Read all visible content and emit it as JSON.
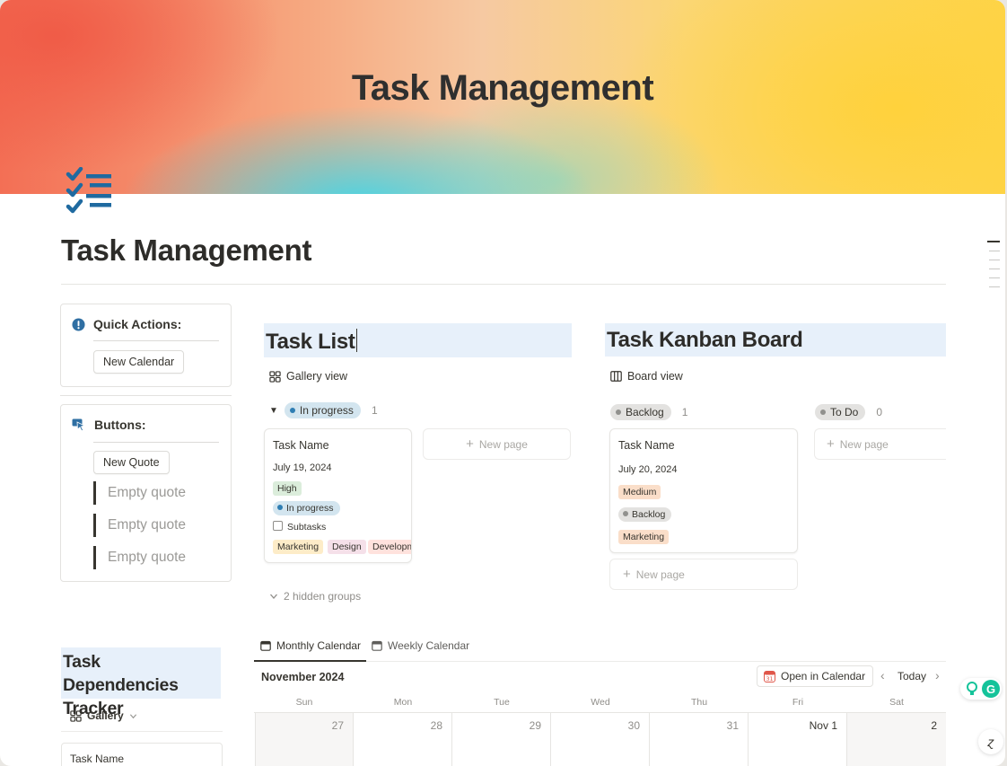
{
  "cover": {
    "title": "Task Management"
  },
  "page": {
    "title": "Task Management"
  },
  "quick_actions": {
    "heading": "Quick Actions:",
    "button": "New Calendar"
  },
  "buttons_block": {
    "heading": "Buttons:",
    "button": "New Quote",
    "quotes": [
      "Empty quote",
      "Empty quote",
      "Empty quote"
    ]
  },
  "task_list": {
    "heading": "Task List",
    "view": "Gallery view",
    "group": {
      "label": "In progress",
      "count": "1"
    },
    "card": {
      "title": "Task Name",
      "date": "July 19, 2024",
      "priority": "High",
      "status": "In progress",
      "subtasks": "Subtasks",
      "tags": [
        "Marketing",
        "Design",
        "Developm"
      ]
    },
    "new_page": "New page",
    "hidden_groups": "2 hidden groups"
  },
  "kanban": {
    "heading": "Task Kanban Board",
    "view": "Board view",
    "columns": [
      {
        "label": "Backlog",
        "count": "1"
      },
      {
        "label": "To Do",
        "count": "0"
      }
    ],
    "card": {
      "title": "Task Name",
      "date": "July 20, 2024",
      "priority": "Medium",
      "status": "Backlog",
      "tag": "Marketing"
    },
    "new_page": "New page"
  },
  "dependencies": {
    "heading": "Task Dependencies Tracker",
    "view": "Gallery",
    "card_title": "Task Name"
  },
  "calendar": {
    "tabs": [
      "Monthly Calendar",
      "Weekly Calendar"
    ],
    "month": "November 2024",
    "open_button": "Open in Calendar",
    "today": "Today",
    "weekdays": [
      "Sun",
      "Mon",
      "Tue",
      "Wed",
      "Thu",
      "Fri",
      "Sat"
    ],
    "days": [
      "27",
      "28",
      "29",
      "30",
      "31",
      "Nov 1",
      "2"
    ]
  },
  "colors": {
    "highlight_blue": "#e7f0fa",
    "tag_high": "#dbeddb",
    "tag_in_progress": "#d3e5ef",
    "tag_marketing": "#fdecc8",
    "tag_design": "#f5e0e9",
    "tag_dev": "#ffe2dd",
    "tag_medium": "#fadec9",
    "tag_backlog": "#e3e2e0",
    "icon_blue": "#2f6fa3"
  },
  "icons": [
    "checklist-icon",
    "exclamation-icon",
    "cursor-click-icon",
    "gallery-icon",
    "board-icon",
    "calendar-icon",
    "chevron-left-icon",
    "chevron-right-icon",
    "plus-icon",
    "grammarly-icon",
    "help-icon"
  ]
}
